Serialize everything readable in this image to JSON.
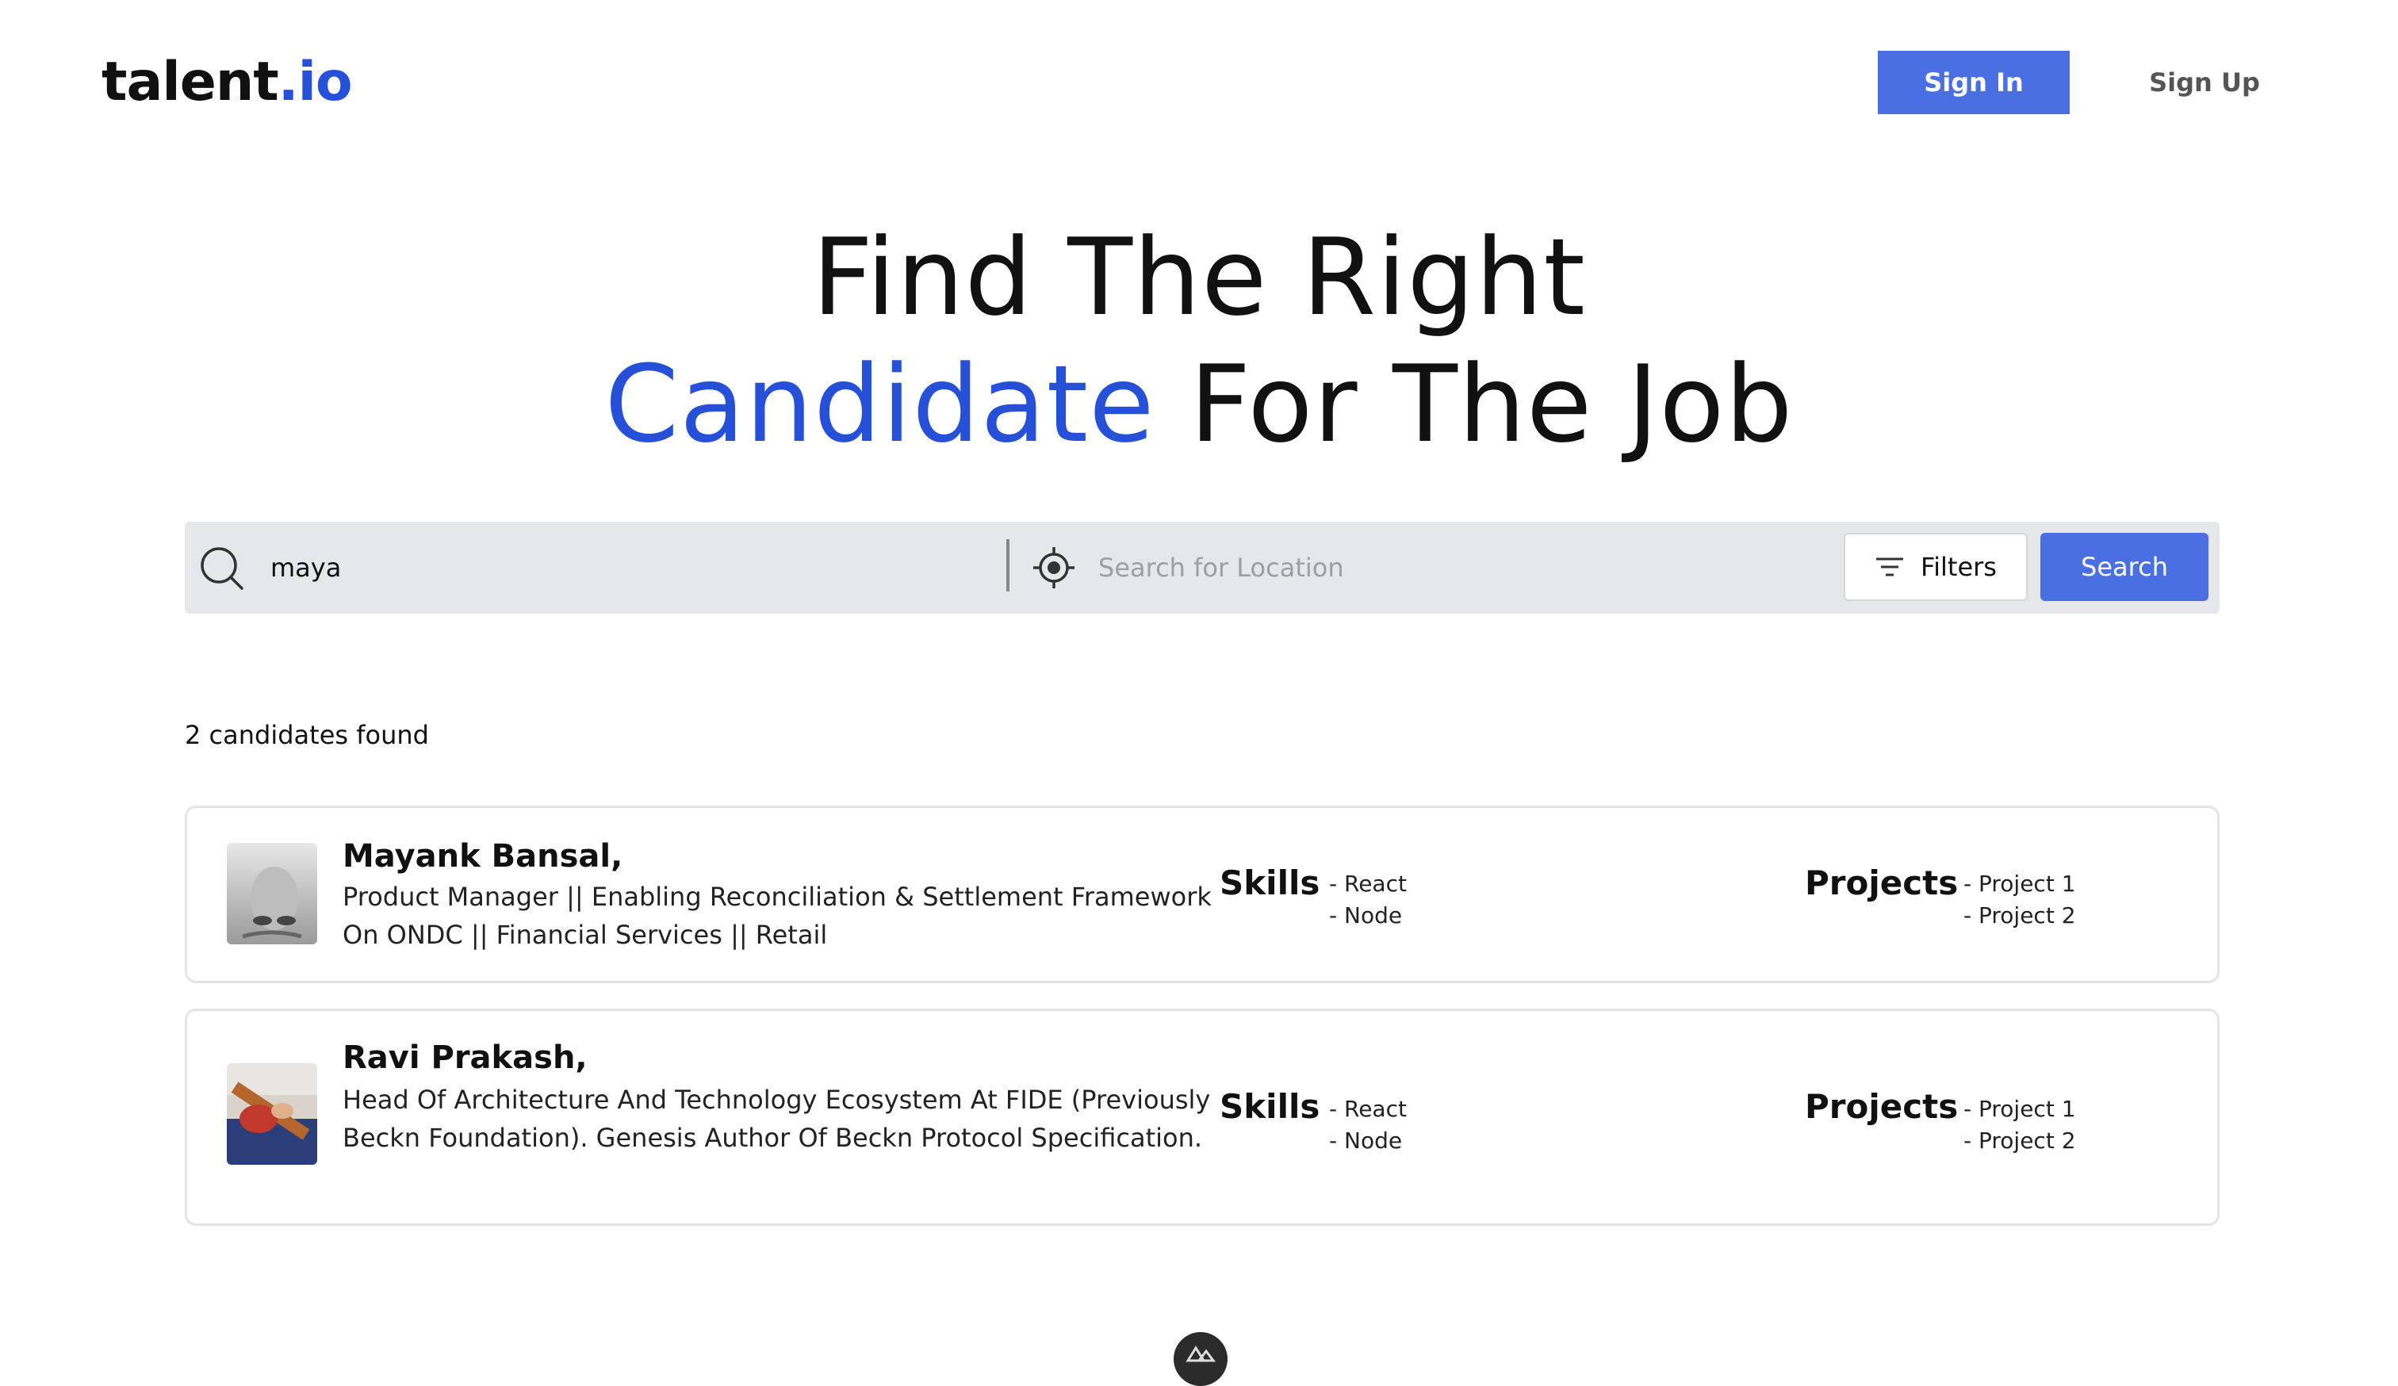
{
  "header": {
    "logo_main": "talent",
    "logo_accent": ".io",
    "sign_in_label": "Sign In",
    "sign_up_label": "Sign Up"
  },
  "hero": {
    "line1": "Find The Right",
    "line2_accent": "Candidate",
    "line2_rest": " For The Job"
  },
  "search": {
    "query_value": "maya",
    "location_placeholder": "Search for Location",
    "filters_label": "Filters",
    "search_label": "Search"
  },
  "results": {
    "count_text": "2 candidates found",
    "candidates": [
      {
        "name": "Mayank Bansal,",
        "headline": "Product Manager || Enabling Reconciliation & Settlement Framework On ONDC || Financial Services || Retail",
        "skills_label": "Skills",
        "skills": [
          "- React",
          "- Node"
        ],
        "projects_label": "Projects",
        "projects": [
          "- Project 1",
          "- Project 2"
        ]
      },
      {
        "name": "Ravi Prakash,",
        "headline": "Head Of Architecture And Technology Ecosystem At FIDE (Previously Beckn Foundation). Genesis Author Of Beckn Protocol Specification.",
        "skills_label": "Skills",
        "skills": [
          "- React",
          "- Node"
        ],
        "projects_label": "Projects",
        "projects": [
          "- Project 1",
          "- Project 2"
        ]
      }
    ]
  },
  "colors": {
    "accent": "#2650d8",
    "button_primary": "#4a6fe3",
    "search_bar_bg": "#e6e7eb"
  }
}
